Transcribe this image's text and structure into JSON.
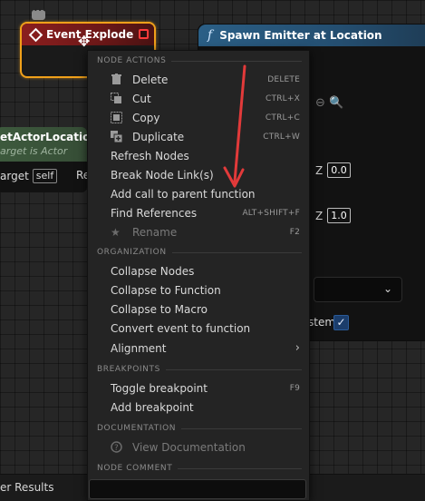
{
  "event_node": {
    "title": "Event Explode"
  },
  "spawn_node": {
    "title": "Spawn Emitter at Location",
    "z_label_1": "Z",
    "z_value_1": "0.0",
    "z_label_2": "Z",
    "z_value_2": "1.0",
    "system_label": "stem",
    "checkbox_checked": true
  },
  "actor_node": {
    "title": "etActorLocation",
    "subtitle": "arget is Actor",
    "target_label": "arget",
    "target_value": "self",
    "return_label": "Re"
  },
  "bottom_bar": {
    "tab_label": "er Results"
  },
  "context_menu": {
    "sections": {
      "node_actions": "NODE ACTIONS",
      "organization": "ORGANIZATION",
      "breakpoints": "BREAKPOINTS",
      "documentation": "DOCUMENTATION",
      "node_comment": "NODE COMMENT"
    },
    "node_actions": [
      {
        "label": "Delete",
        "shortcut": "DELETE",
        "icon": "trash-icon"
      },
      {
        "label": "Cut",
        "shortcut": "CTRL+X",
        "icon": "cut-icon"
      },
      {
        "label": "Copy",
        "shortcut": "CTRL+C",
        "icon": "copy-icon"
      },
      {
        "label": "Duplicate",
        "shortcut": "CTRL+W",
        "icon": "duplicate-icon"
      },
      {
        "label": "Refresh Nodes",
        "shortcut": ""
      },
      {
        "label": "Break Node Link(s)",
        "shortcut": ""
      },
      {
        "label": "Add call to parent function",
        "shortcut": ""
      },
      {
        "label": "Find References",
        "shortcut": "ALT+SHIFT+F"
      },
      {
        "label": "Rename",
        "shortcut": "F2",
        "icon": "star-icon",
        "disabled": true
      }
    ],
    "organization": [
      {
        "label": "Collapse Nodes"
      },
      {
        "label": "Collapse to Function"
      },
      {
        "label": "Collapse to Macro"
      },
      {
        "label": "Convert event to function"
      },
      {
        "label": "Alignment",
        "submenu": true
      }
    ],
    "breakpoints": [
      {
        "label": "Toggle breakpoint",
        "shortcut": "F9"
      },
      {
        "label": "Add breakpoint",
        "shortcut": ""
      }
    ],
    "documentation": [
      {
        "label": "View Documentation",
        "icon": "help-icon",
        "disabled": true
      }
    ],
    "node_comment_value": ""
  },
  "colors": {
    "event_border": "#f0a01a",
    "annotation_arrow": "#e23a3a",
    "spawn_header": "#2b5f86",
    "menu_bg": "#242424"
  }
}
